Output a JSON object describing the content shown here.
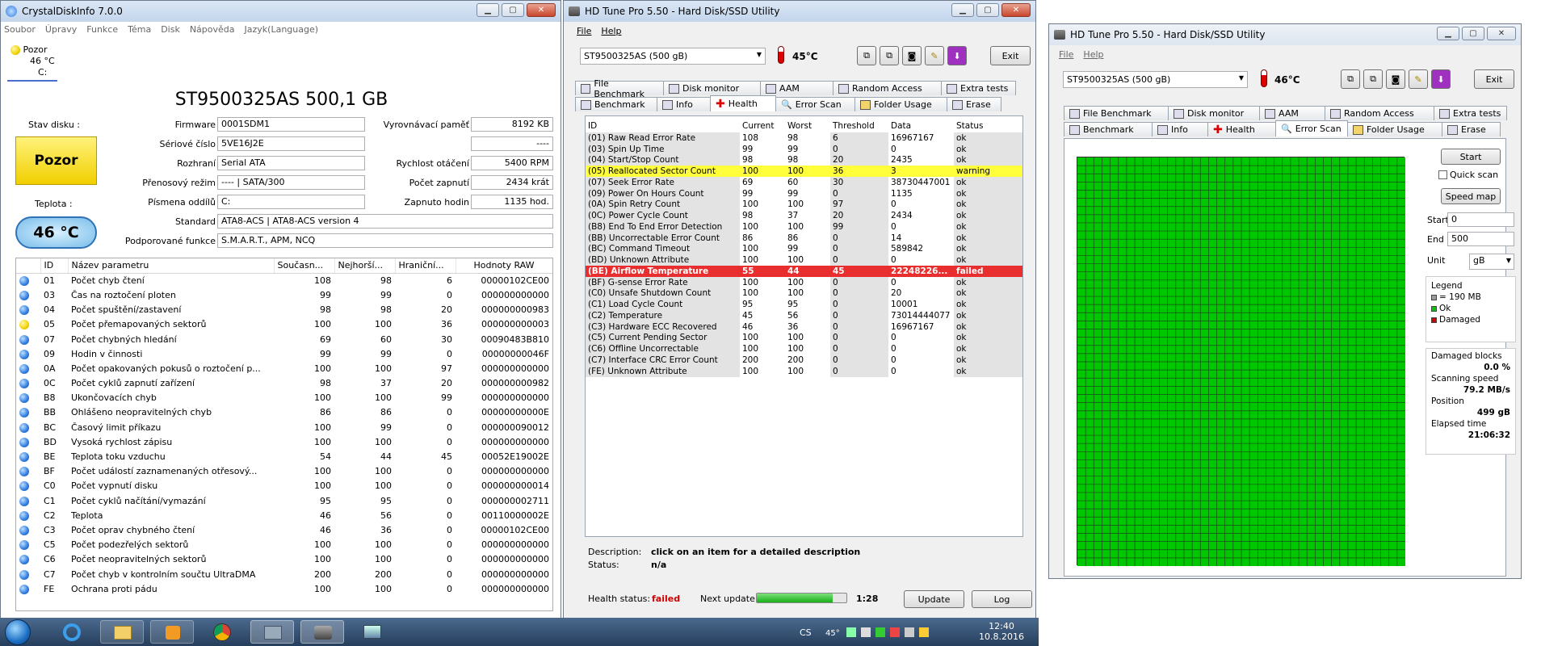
{
  "cdi": {
    "title": "CrystalDiskInfo 7.0.0",
    "menu": [
      "Soubor",
      "Úpravy",
      "Funkce",
      "Téma",
      "Disk",
      "Nápověda",
      "Jazyk(Language)"
    ],
    "drive_tab": {
      "status": "Pozor",
      "temp": "46 °C",
      "letter": "C:"
    },
    "model": "ST9500325AS 500,1 GB",
    "labels": {
      "status": "Stav disku :",
      "temp": "Teplota :",
      "firmware": "Firmware",
      "serial": "Sériové číslo",
      "interface": "Rozhraní",
      "mode": "Přenosový režim",
      "letters": "Písmena oddílů",
      "standard": "Standard",
      "features": "Podporované funkce",
      "buffer": "Vyrovnávací paměť",
      "rpm": "Rychlost otáčení",
      "poweron_count": "Počet zapnutí",
      "poweron_hours": "Zapnuto hodin"
    },
    "values": {
      "status": "Pozor",
      "temp": "46 °C",
      "firmware": "0001SDM1",
      "serial": "5VE16J2E",
      "interface": "Serial ATA",
      "mode": "---- | SATA/300",
      "letters": "C:",
      "standard": "ATA8-ACS | ATA8-ACS version 4",
      "features": "S.M.A.R.T., APM, NCQ",
      "buffer": "8192 KB",
      "blank1": "----",
      "blank2": "----",
      "rpm": "5400 RPM",
      "poweron_count": "2434 krát",
      "poweron_hours": "1135 hod."
    },
    "headers": [
      "ID",
      "Název parametru",
      "Současn...",
      "Nejhorší...",
      "Hraniční...",
      "Hodnoty RAW"
    ],
    "rows": [
      [
        "b",
        "01",
        "Počet chyb čtení",
        "108",
        "98",
        "6",
        "00000102CE00"
      ],
      [
        "b",
        "03",
        "Čas na roztočení ploten",
        "99",
        "99",
        "0",
        "000000000000"
      ],
      [
        "b",
        "04",
        "Počet spuštění/zastavení",
        "98",
        "98",
        "20",
        "000000000983"
      ],
      [
        "y",
        "05",
        "Počet přemapovaných sektorů",
        "100",
        "100",
        "36",
        "000000000003"
      ],
      [
        "b",
        "07",
        "Počet chybných hledání",
        "69",
        "60",
        "30",
        "00090483B810"
      ],
      [
        "b",
        "09",
        "Hodin v činnosti",
        "99",
        "99",
        "0",
        "00000000046F"
      ],
      [
        "b",
        "0A",
        "Počet opakovaných pokusů o roztočení p...",
        "100",
        "100",
        "97",
        "000000000000"
      ],
      [
        "b",
        "0C",
        "Počet cyklů zapnutí zařízení",
        "98",
        "37",
        "20",
        "000000000982"
      ],
      [
        "b",
        "B8",
        "Ukončovacích chyb",
        "100",
        "100",
        "99",
        "000000000000"
      ],
      [
        "b",
        "BB",
        "Ohlášeno neopravitelných chyb",
        "86",
        "86",
        "0",
        "00000000000E"
      ],
      [
        "b",
        "BC",
        "Časový limit příkazu",
        "100",
        "99",
        "0",
        "000000090012"
      ],
      [
        "b",
        "BD",
        "Vysoká rychlost zápisu",
        "100",
        "100",
        "0",
        "000000000000"
      ],
      [
        "b",
        "BE",
        "Teplota toku vzduchu",
        "54",
        "44",
        "45",
        "00052E19002E"
      ],
      [
        "b",
        "BF",
        "Počet událostí zaznamenaných otřesový...",
        "100",
        "100",
        "0",
        "000000000000"
      ],
      [
        "b",
        "C0",
        "Počet vypnutí disku",
        "100",
        "100",
        "0",
        "000000000014"
      ],
      [
        "b",
        "C1",
        "Počet cyklů načítání/vymazání",
        "95",
        "95",
        "0",
        "000000002711"
      ],
      [
        "b",
        "C2",
        "Teplota",
        "46",
        "56",
        "0",
        "00110000002E"
      ],
      [
        "b",
        "C3",
        "Počet oprav chybného čtení",
        "46",
        "36",
        "0",
        "00000102CE00"
      ],
      [
        "b",
        "C5",
        "Počet podezřelých sektorů",
        "100",
        "100",
        "0",
        "000000000000"
      ],
      [
        "b",
        "C6",
        "Počet neopravitelných sektorů",
        "100",
        "100",
        "0",
        "000000000000"
      ],
      [
        "b",
        "C7",
        "Počet chyb v kontrolním součtu UltraDMA",
        "200",
        "200",
        "0",
        "000000000000"
      ],
      [
        "b",
        "FE",
        "Ochrana proti pádu",
        "100",
        "100",
        "0",
        "000000000000"
      ]
    ]
  },
  "hdt1": {
    "title": "HD Tune Pro 5.50 - Hard Disk/SSD Utility",
    "menu": [
      "File",
      "Help"
    ],
    "drive": "ST9500325AS (500 gB)",
    "temp": "45°C",
    "exit": "Exit",
    "tabs_top": [
      "File Benchmark",
      "Disk monitor",
      "AAM",
      "Random Access",
      "Extra tests"
    ],
    "tabs_bottom": [
      "Benchmark",
      "Info",
      "Health",
      "Error Scan",
      "Folder Usage",
      "Erase"
    ],
    "headers": [
      "ID",
      "Current",
      "Worst",
      "Threshold",
      "Data",
      "Status"
    ],
    "rows": [
      [
        "(01) Raw Read Error Rate",
        "108",
        "98",
        "6",
        "16967167",
        "ok",
        ""
      ],
      [
        "(03) Spin Up Time",
        "99",
        "99",
        "0",
        "0",
        "ok",
        ""
      ],
      [
        "(04) Start/Stop Count",
        "98",
        "98",
        "20",
        "2435",
        "ok",
        ""
      ],
      [
        "(05) Reallocated Sector Count",
        "100",
        "100",
        "36",
        "3",
        "warning",
        "warn"
      ],
      [
        "(07) Seek Error Rate",
        "69",
        "60",
        "30",
        "38730447001",
        "ok",
        ""
      ],
      [
        "(09) Power On Hours Count",
        "99",
        "99",
        "0",
        "1135",
        "ok",
        ""
      ],
      [
        "(0A) Spin Retry Count",
        "100",
        "100",
        "97",
        "0",
        "ok",
        ""
      ],
      [
        "(0C) Power Cycle Count",
        "98",
        "37",
        "20",
        "2434",
        "ok",
        ""
      ],
      [
        "(B8) End To End Error Detection",
        "100",
        "100",
        "99",
        "0",
        "ok",
        ""
      ],
      [
        "(BB) Uncorrectable Error Count",
        "86",
        "86",
        "0",
        "14",
        "ok",
        ""
      ],
      [
        "(BC) Command Timeout",
        "100",
        "99",
        "0",
        "589842",
        "ok",
        ""
      ],
      [
        "(BD) Unknown Attribute",
        "100",
        "100",
        "0",
        "0",
        "ok",
        ""
      ],
      [
        "(BE) Airflow Temperature",
        "55",
        "44",
        "45",
        "22248226...",
        "failed",
        "fail"
      ],
      [
        "(BF) G-sense Error Rate",
        "100",
        "100",
        "0",
        "0",
        "ok",
        ""
      ],
      [
        "(C0) Unsafe Shutdown Count",
        "100",
        "100",
        "0",
        "20",
        "ok",
        ""
      ],
      [
        "(C1) Load Cycle Count",
        "95",
        "95",
        "0",
        "10001",
        "ok",
        ""
      ],
      [
        "(C2) Temperature",
        "45",
        "56",
        "0",
        "73014444077",
        "ok",
        ""
      ],
      [
        "(C3) Hardware ECC Recovered",
        "46",
        "36",
        "0",
        "16967167",
        "ok",
        ""
      ],
      [
        "(C5) Current Pending Sector",
        "100",
        "100",
        "0",
        "0",
        "ok",
        ""
      ],
      [
        "(C6) Offline Uncorrectable",
        "100",
        "100",
        "0",
        "0",
        "ok",
        ""
      ],
      [
        "(C7) Interface CRC Error Count",
        "200",
        "200",
        "0",
        "0",
        "ok",
        ""
      ],
      [
        "(FE) Unknown Attribute",
        "100",
        "100",
        "0",
        "0",
        "ok",
        ""
      ]
    ],
    "desc_label": "Description:",
    "desc": "click on an item for a detailed description",
    "status_label": "Status:",
    "status": "n/a",
    "health_label": "Health status:",
    "health": "failed",
    "next_label": "Next update:",
    "next_time": "1:28",
    "next_progress": 0.85,
    "update": "Update",
    "log": "Log"
  },
  "hdt2": {
    "title": "HD Tune Pro 5.50 - Hard Disk/SSD Utility",
    "menu": [
      "File",
      "Help"
    ],
    "drive": "ST9500325AS (500 gB)",
    "temp": "46°C",
    "exit": "Exit",
    "tabs_top": [
      "File Benchmark",
      "Disk monitor",
      "AAM",
      "Random Access",
      "Extra tests"
    ],
    "tabs_bottom": [
      "Benchmark",
      "Info",
      "Health",
      "Error Scan",
      "Folder Usage",
      "Erase"
    ],
    "start_btn": "Start",
    "quick": "Quick scan",
    "speedmap": "Speed map",
    "start_label": "Start",
    "start_val": "0",
    "end_label": "End",
    "end_val": "500",
    "unit_label": "Unit",
    "unit_val": "gB",
    "legend_title": "Legend",
    "legend": [
      {
        "text": "= 190 MB",
        "color": "#9a9a9a"
      },
      {
        "text": "Ok",
        "color": "#00c800"
      },
      {
        "text": "Damaged",
        "color": "#d00000"
      }
    ],
    "damaged_label": "Damaged blocks",
    "damaged": "0.0 %",
    "speed_label": "Scanning speed",
    "speed": "79.2 MB/s",
    "position_label": "Position",
    "position": "499 gB",
    "elapsed_label": "Elapsed time",
    "elapsed": "21:06:32",
    "ok_color": "#00c800"
  },
  "taskbar": {
    "lang": "CS",
    "temp": "45°",
    "time": "12:40",
    "date": "10.8.2016"
  }
}
